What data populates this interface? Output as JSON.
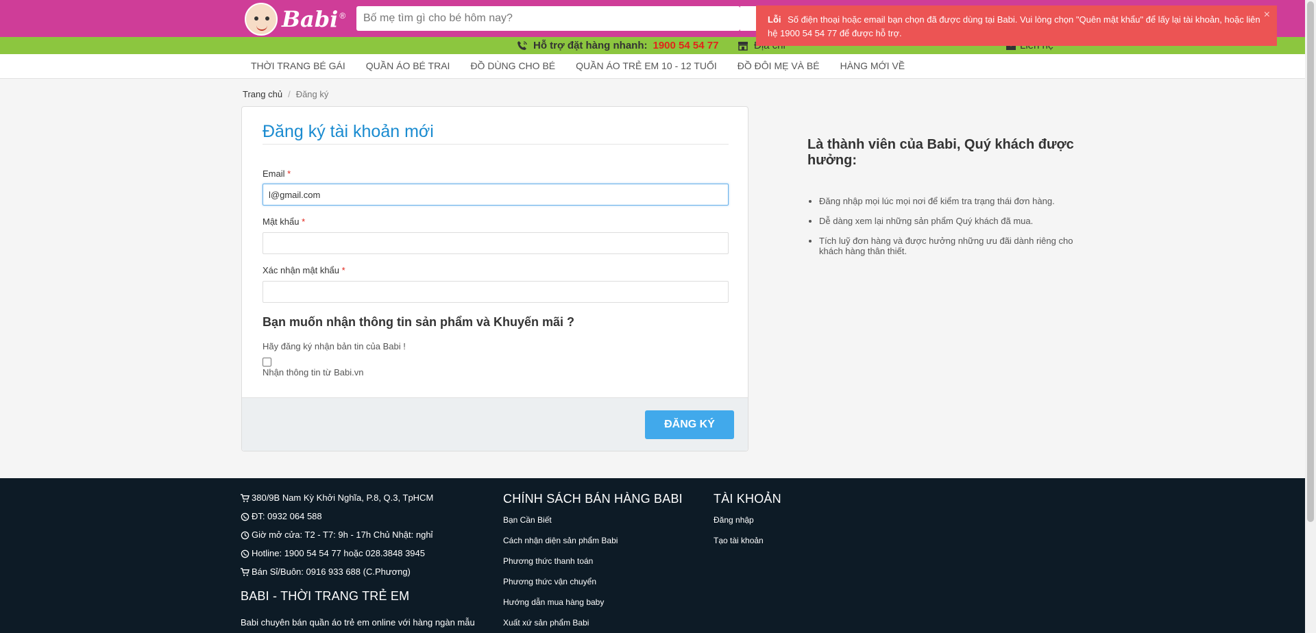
{
  "header": {
    "logo_text": "Babi",
    "search_placeholder": "Bố mẹ tìm gì cho bé hôm nay?",
    "hotline_label": "Hỗ trợ đặt hàng nhanh:",
    "hotline_number": "1900 54 54 77",
    "address_label": "Địa chỉ",
    "contact_label": "Liên hệ"
  },
  "nav": {
    "items": [
      "THỜI TRANG BÉ GÁI",
      "QUẦN ÁO BÉ TRAI",
      "ĐỒ DÙNG CHO BÉ",
      "QUẦN ÁO TRẺ EM 10 - 12 TUỔI",
      "ĐỒ ĐÔI MẸ VÀ BÉ",
      "HÀNG MỚI VỀ"
    ]
  },
  "breadcrumb": {
    "home": "Trang chủ",
    "separator": "/",
    "current": "Đăng ký"
  },
  "form": {
    "title": "Đăng ký tài khoản mới",
    "email_label": "Email",
    "email_value": "l@gmail.com",
    "password_label": "Mật khẩu",
    "password_value": "",
    "confirm_label": "Xác nhận mật khẩu",
    "confirm_value": "",
    "required_mark": "*",
    "newsletter_heading": "Bạn muốn nhận thông tin sản phẩm và Khuyến mãi ?",
    "newsletter_hint": "Hãy đăng ký nhận bản tin của Babi !",
    "newsletter_checkbox_label": "Nhận thông tin từ Babi.vn",
    "newsletter_checked": false,
    "submit_label": "ĐĂNG KÝ"
  },
  "benefits": {
    "heading": "Là thành viên của Babi, Quý khách được hưởng:",
    "items": [
      "Đăng nhập mọi lúc mọi nơi để kiểm tra trạng thái đơn hàng.",
      "Dễ dàng xem lại những sản phẩm Quý khách đã mua.",
      "Tích luỹ đơn hàng và được hưởng những ưu đãi dành riêng cho khách hàng thân thiết."
    ]
  },
  "alert": {
    "title": "Lỗi",
    "message": "Số điện thoại hoặc email bạn chọn đã được dùng tại Babi. Vui lòng chọn \"Quên mật khẩu\" để lấy lại tài khoản, hoặc liên hệ 1900 54 54 77 để được hỗ trợ.",
    "close": "×"
  },
  "footer": {
    "contact_lines": [
      {
        "icon": "cart-icon",
        "text": "380/9B Nam Kỳ Khởi Nghĩa, P.8, Q.3, TpHCM"
      },
      {
        "icon": "whatsapp-icon",
        "text": "ĐT: 0932 064 588"
      },
      {
        "icon": "clock-icon",
        "text": "Giờ mở cửa: T2 - T7: 9h - 17h Chủ Nhật: nghỉ"
      },
      {
        "icon": "whatsapp-icon",
        "text": "Hotline: 1900 54 54 77 hoặc 028.3848 3945"
      },
      {
        "icon": "cart-icon",
        "text": "Bán Sỉ/Buôn: 0916 933 688 (C.Phương)"
      }
    ],
    "brand_heading": "BABI - THỜI TRANG TRẺ EM",
    "brand_desc": "Babi chuyên bán quần áo trẻ em online với hàng ngàn mẫu",
    "policy_heading": "CHÍNH SÁCH BÁN HÀNG BABI",
    "policy_links": [
      "Bạn Cần Biết",
      "Cách nhận diện sản phẩm Babi",
      "Phương thức thanh toán",
      "Phương thức vận chuyển",
      "Hướng dẫn mua hàng baby",
      "Xuất xứ sản phẩm Babi"
    ],
    "account_heading": "TÀI KHOẢN",
    "account_links": [
      "Đăng nhập",
      "Tạo tài khoản"
    ]
  },
  "colors": {
    "brand_pink": "#cf3d98",
    "brand_green": "#8cc63f",
    "title_blue": "#1a8bd0",
    "button_blue": "#41a9eb",
    "alert_red": "#ec5454",
    "footer_navy": "#0d1b26"
  }
}
